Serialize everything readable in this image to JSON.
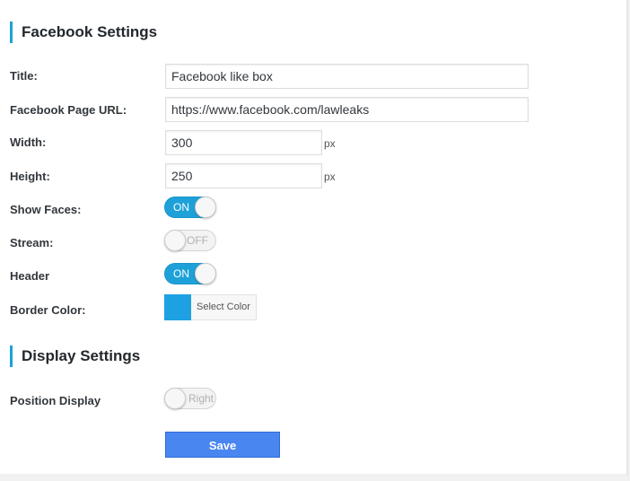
{
  "facebook_settings": {
    "heading": "Facebook Settings",
    "title": {
      "label": "Title:",
      "value": "Facebook like box"
    },
    "page_url": {
      "label": "Facebook Page URL:",
      "value": "https://www.facebook.com/lawleaks"
    },
    "width": {
      "label": "Width:",
      "value": "300",
      "unit": "px"
    },
    "height": {
      "label": "Height:",
      "value": "250",
      "unit": "px"
    },
    "show_faces": {
      "label": "Show Faces:",
      "state": "ON"
    },
    "stream": {
      "label": "Stream:",
      "state": "OFF"
    },
    "header": {
      "label": "Header",
      "state": "ON"
    },
    "border_color": {
      "label": "Border Color:",
      "button_text": "Select Color",
      "color": "#1ea1e3"
    }
  },
  "display_settings": {
    "heading": "Display Settings",
    "position_display": {
      "label": "Position Display",
      "state": "Right"
    }
  },
  "save_button": "Save",
  "colors": {
    "accent": "#1ea1d8",
    "save_button": "#4a86f0"
  }
}
